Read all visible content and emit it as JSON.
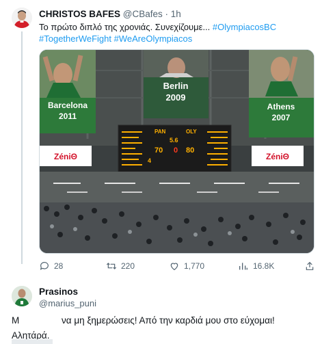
{
  "tweet": {
    "author_name": "CHRISTOS BAFES",
    "handle": "@CBafes",
    "separator": "·",
    "time": "1h",
    "text": "Το πρώτο διπλό της χρονιάς. Συνεχίζουμε...",
    "hashtags": [
      "#OlympiacosBC",
      "#TogetherWeFight",
      "#WeAreOlympiacos"
    ],
    "photo": {
      "banners": [
        {
          "city": "Barcelona",
          "year": "2011"
        },
        {
          "city": "Berlin",
          "year": "2009"
        },
        {
          "city": "Athens",
          "year": "2007"
        }
      ],
      "ads": [
        "ZéniΘ",
        "ZéniΘ"
      ],
      "scoreboard": {
        "home_label": "PAN",
        "away_label": "OLY",
        "home_score": "70",
        "away_score": "80",
        "period": "4",
        "clock": "5.6",
        "shot_clock": "0"
      }
    },
    "actions": {
      "replies": "28",
      "retweets": "220",
      "likes": "1,770",
      "views": "16.8K"
    }
  },
  "reply": {
    "author_name": "Prasinos",
    "handle": "@marius_puni",
    "text_start": "Μ",
    "text_rest": "να μη ξημερώσεις! Από την καρδιά μου στο εύχομαι!",
    "text_line2": "Αλητάρά."
  },
  "colors": {
    "link": "#1d9bf0",
    "muted": "#536471",
    "scoreboard": "#ffb000"
  }
}
